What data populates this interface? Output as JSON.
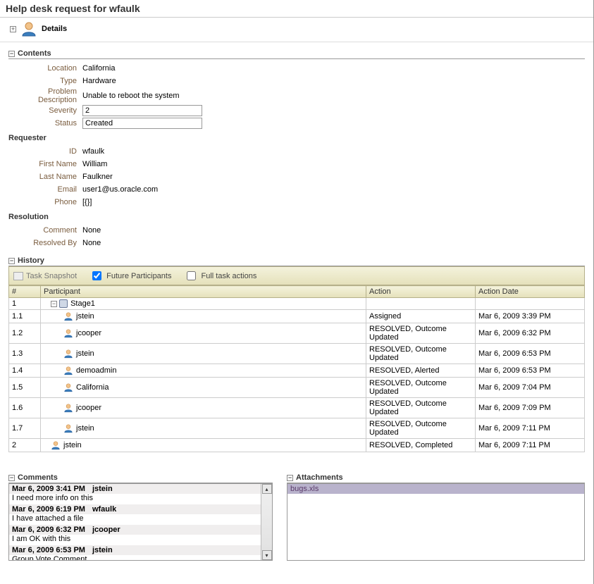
{
  "title": "Help desk request for wfaulk",
  "details_label": "Details",
  "sections": {
    "contents": "Contents",
    "requester": "Requester",
    "resolution": "Resolution",
    "history": "History",
    "comments": "Comments",
    "attachments": "Attachments"
  },
  "contents": {
    "labels": {
      "location": "Location",
      "type": "Type",
      "problem_desc": "Problem Description",
      "severity": "Severity",
      "status": "Status"
    },
    "location": "California",
    "type": "Hardware",
    "problem_desc": "Unable to reboot the system",
    "severity": "2",
    "status": "Created"
  },
  "requester": {
    "labels": {
      "id": "ID",
      "first_name": "First Name",
      "last_name": "Last Name",
      "email": "Email",
      "phone": "Phone"
    },
    "id": "wfaulk",
    "first_name": "William",
    "last_name": "Faulkner",
    "email": "user1@us.oracle.com",
    "phone": "[{}]"
  },
  "resolution": {
    "labels": {
      "comment": "Comment",
      "resolved_by": "Resolved By"
    },
    "comment": "None",
    "resolved_by": "None"
  },
  "history_toolbar": {
    "snapshot": "Task Snapshot",
    "future": "Future Participants",
    "full": "Full task actions"
  },
  "history": {
    "columns": {
      "num": "#",
      "participant": "Participant",
      "action": "Action",
      "date": "Action Date"
    },
    "rows": [
      {
        "num": "1",
        "participant": "Stage1",
        "action": "",
        "date": "",
        "kind": "stage"
      },
      {
        "num": "1.1",
        "participant": "jstein",
        "action": "Assigned",
        "date": "Mar 6, 2009 3:39 PM",
        "kind": "user"
      },
      {
        "num": "1.2",
        "participant": "jcooper",
        "action": "RESOLVED, Outcome Updated",
        "date": "Mar 6, 2009 6:32 PM",
        "kind": "user"
      },
      {
        "num": "1.3",
        "participant": "jstein",
        "action": "RESOLVED, Outcome Updated",
        "date": "Mar 6, 2009 6:53 PM",
        "kind": "user"
      },
      {
        "num": "1.4",
        "participant": "demoadmin",
        "action": "RESOLVED, Alerted",
        "date": "Mar 6, 2009 6:53 PM",
        "kind": "user"
      },
      {
        "num": "1.5",
        "participant": "California",
        "action": "RESOLVED, Outcome Updated",
        "date": "Mar 6, 2009 7:04 PM",
        "kind": "user"
      },
      {
        "num": "1.6",
        "participant": "jcooper",
        "action": "RESOLVED, Outcome Updated",
        "date": "Mar 6, 2009 7:09 PM",
        "kind": "user"
      },
      {
        "num": "1.7",
        "participant": "jstein",
        "action": "RESOLVED, Outcome Updated",
        "date": "Mar 6, 2009 7:11 PM",
        "kind": "user"
      },
      {
        "num": "2",
        "participant": "jstein",
        "action": "RESOLVED, Completed",
        "date": "Mar 6, 2009 7:11 PM",
        "kind": "user-top"
      }
    ]
  },
  "comments": [
    {
      "date": "Mar 6, 2009 3:41 PM",
      "user": "jstein",
      "text": "I need more info on this"
    },
    {
      "date": "Mar 6, 2009 6:19 PM",
      "user": "wfaulk",
      "text": "I have attached a file"
    },
    {
      "date": "Mar 6, 2009 6:32 PM",
      "user": "jcooper",
      "text": "I am OK with this"
    },
    {
      "date": "Mar 6, 2009 6:53 PM",
      "user": "jstein",
      "text": "Group Vote Comment"
    }
  ],
  "attachments": [
    "bugs.xls"
  ]
}
